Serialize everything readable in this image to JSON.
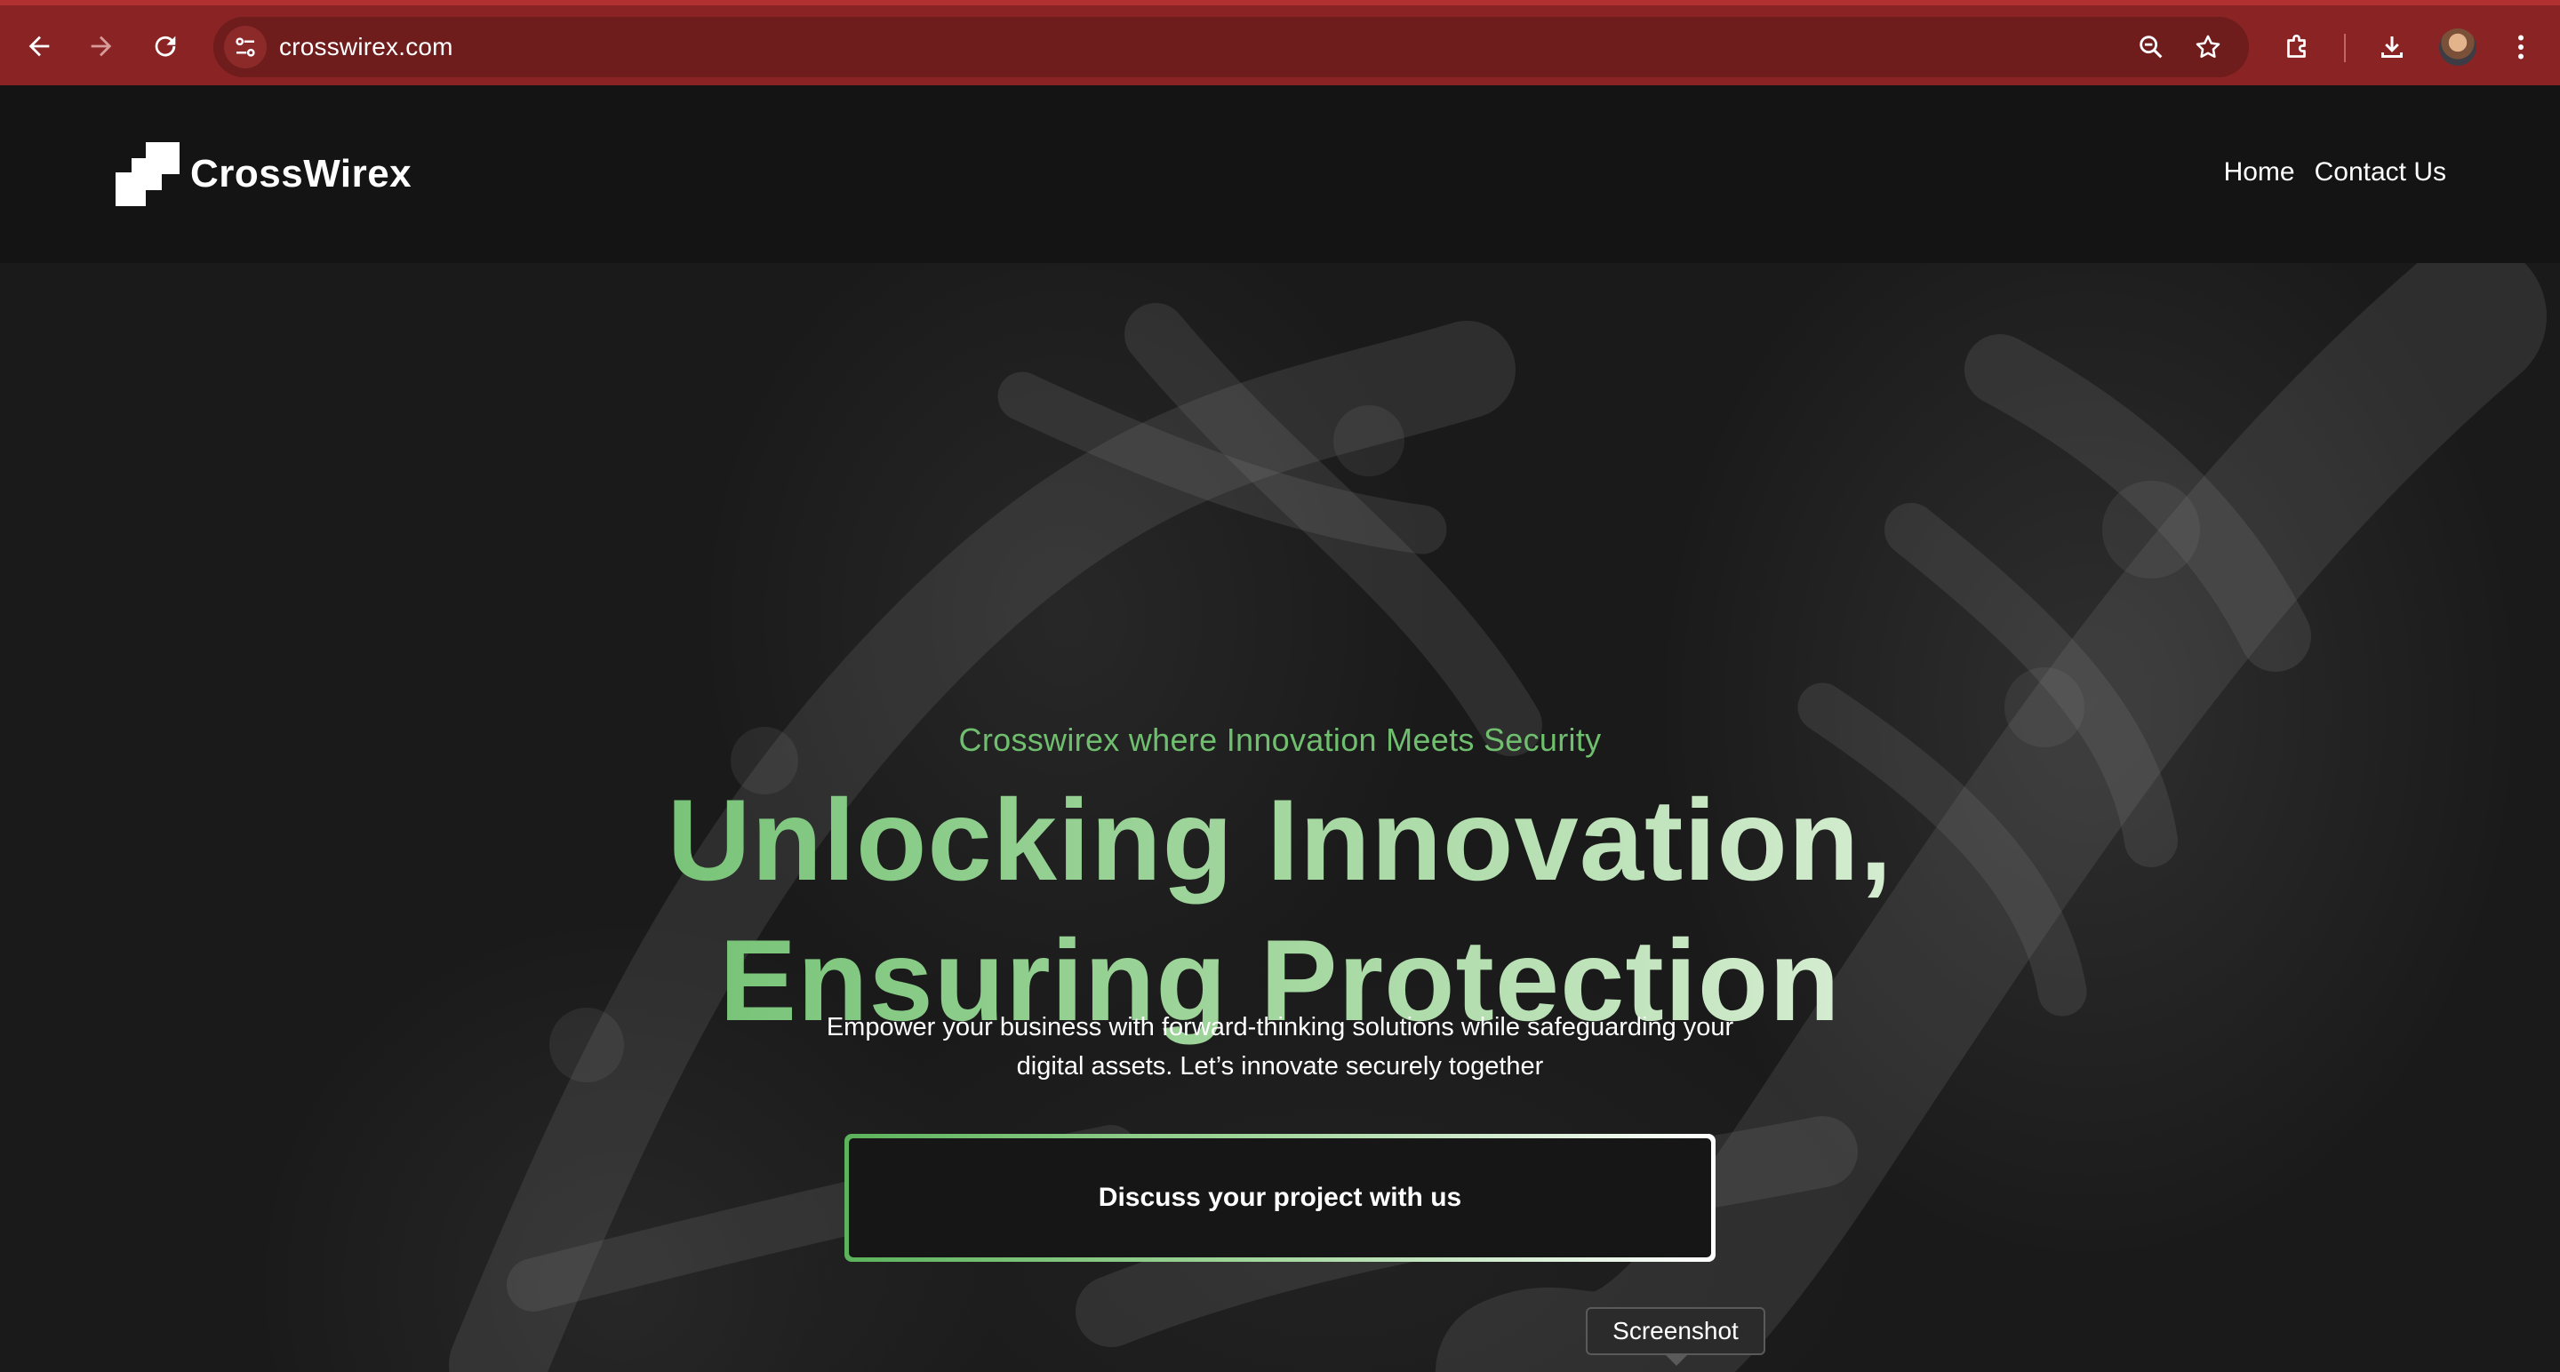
{
  "browser": {
    "url": "crosswirex.com",
    "icons": {
      "back": "arrow-left-icon",
      "forward": "arrow-right-icon",
      "reload": "reload-icon",
      "site_info": "tune-icon",
      "zoom": "zoom-out-icon",
      "bookmark": "star-icon",
      "extensions": "puzzle-icon",
      "downloads": "download-icon",
      "menu": "kebab-menu-icon"
    },
    "theme_color": "#8a2424"
  },
  "site": {
    "brand_name": "CrossWirex",
    "nav": [
      {
        "label": "Home"
      },
      {
        "label": "Contact Us"
      }
    ]
  },
  "hero": {
    "eyebrow": "Crosswirex where Innovation Meets Security",
    "headline_line1": "Unlocking Innovation,",
    "headline_line2": "Ensuring Protection",
    "subtext_line1": "Empower your business with forward-thinking solutions while safeguarding your",
    "subtext_line2": "digital assets. Let’s innovate securely together",
    "cta_label": "Discuss your project with us",
    "accent_color": "#6fbf6f"
  },
  "tooltip": {
    "text": "Screenshot"
  }
}
